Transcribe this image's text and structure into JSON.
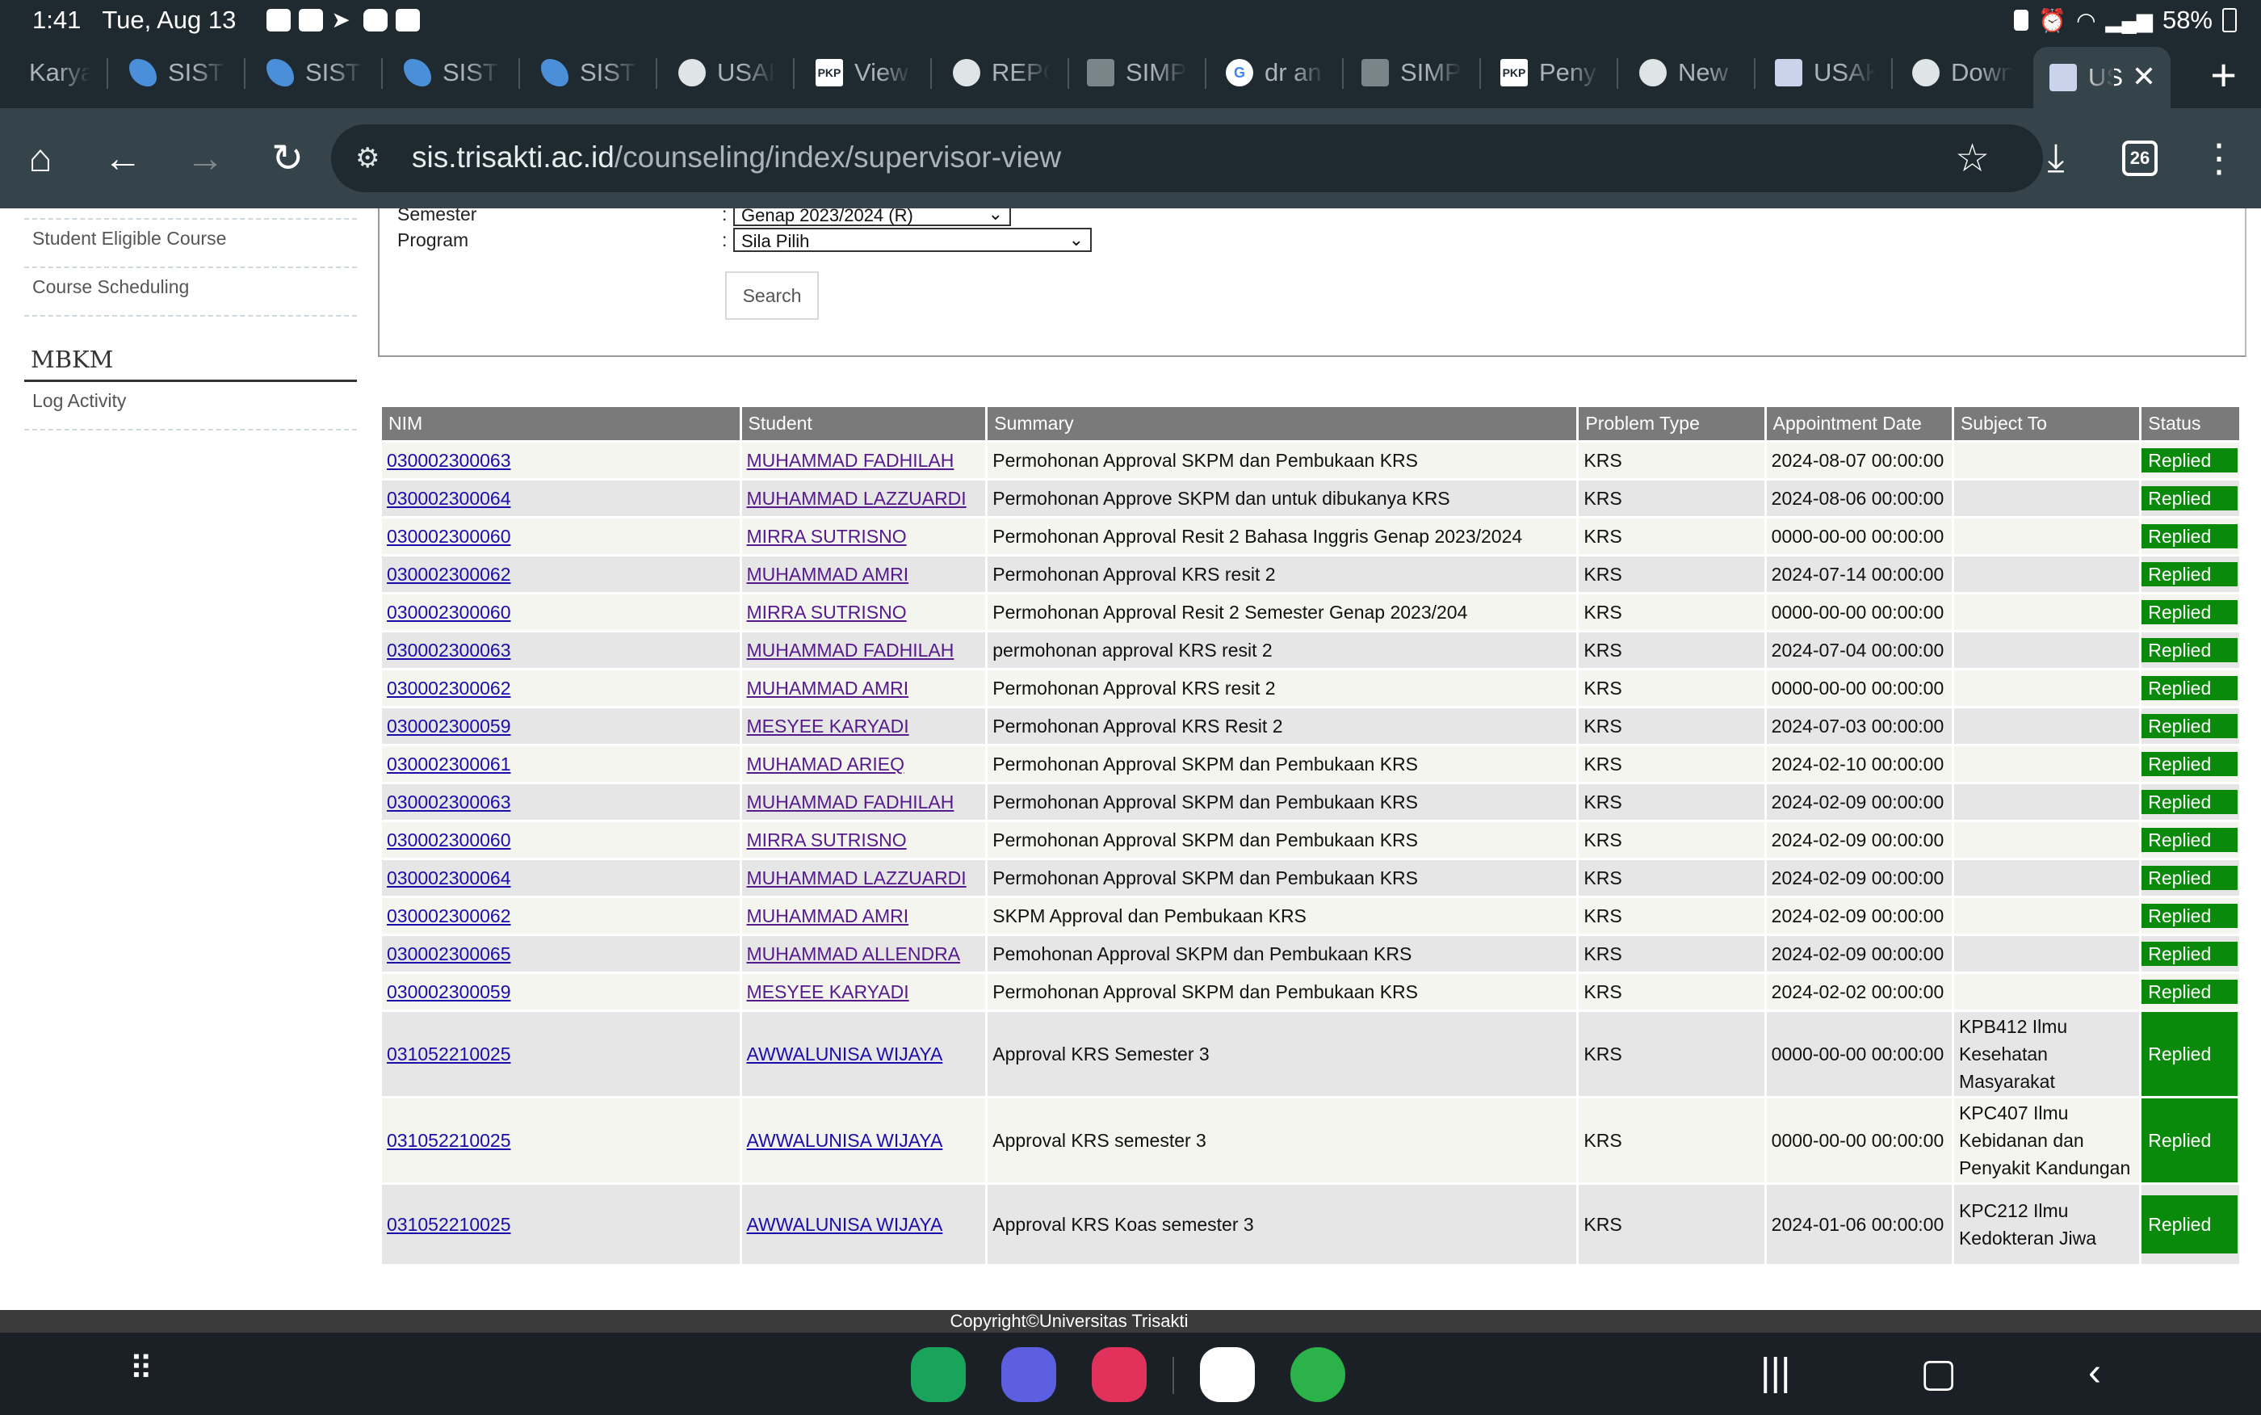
{
  "status_bar": {
    "time": "1:41",
    "date": "Tue, Aug 13",
    "battery": "58%",
    "notification_icons": [
      "youtube-icon",
      "calendar-icon",
      "telegram-icon",
      "app-icon",
      "gallery-icon"
    ],
    "system_icons": [
      "alarm-icon",
      "lock-icon",
      "wifi-icon",
      "signal-icon"
    ]
  },
  "tabs": [
    {
      "label": "Karya",
      "icon": "none"
    },
    {
      "label": "SISTE",
      "icon": "swirl-icon"
    },
    {
      "label": "SISTE",
      "icon": "swirl-icon"
    },
    {
      "label": "SISTE",
      "icon": "swirl-icon"
    },
    {
      "label": "SISTE",
      "icon": "swirl-icon"
    },
    {
      "label": "USAK",
      "icon": "globe-icon"
    },
    {
      "label": "View",
      "icon": "pkp-icon"
    },
    {
      "label": "REPO",
      "icon": "globe-icon"
    },
    {
      "label": "SIMP",
      "icon": "crest-icon"
    },
    {
      "label": "dr an",
      "icon": "google-icon"
    },
    {
      "label": "SIMP",
      "icon": "crest-icon"
    },
    {
      "label": "Peny",
      "icon": "pkp-icon"
    },
    {
      "label": "New",
      "icon": "chrome-icon"
    },
    {
      "label": "USAK",
      "icon": "usak-icon"
    },
    {
      "label": "Down",
      "icon": "chrome-icon"
    },
    {
      "label": "US",
      "icon": "usak-icon"
    }
  ],
  "toolbar": {
    "url_domain": "sis.trisakti.ac.id",
    "url_path": "/counseling/index/supervisor-view",
    "tab_count": "26"
  },
  "sidebar": {
    "items": [
      "Student Eligible Course",
      "Course Scheduling"
    ],
    "section_heading": "MBKM",
    "section_items": [
      "Log Activity"
    ]
  },
  "filters": {
    "semester_label": "Semester",
    "semester_value": "Genap 2023/2024 (R)",
    "program_label": "Program",
    "program_value": "Sila Pilih",
    "search_button": "Search"
  },
  "table": {
    "headers": [
      "NIM",
      "Student",
      "Summary",
      "Problem Type",
      "Appointment Date",
      "Subject To",
      "Status"
    ],
    "rows": [
      {
        "nim": "030002300063",
        "student": "MUHAMMAD FADHILAH",
        "summary": "Permohonan Approval SKPM dan Pembukaan KRS",
        "type": "KRS",
        "date": "2024-08-07 00:00:00",
        "subject": "",
        "status": "Replied"
      },
      {
        "nim": "030002300064",
        "student": "MUHAMMAD LAZZUARDI",
        "summary": "Permohonan Approve SKPM dan untuk dibukanya KRS",
        "type": "KRS",
        "date": "2024-08-06 00:00:00",
        "subject": "",
        "status": "Replied"
      },
      {
        "nim": "030002300060",
        "student": "MIRRA SUTRISNO",
        "summary": "Permohonan Approval Resit 2 Bahasa Inggris Genap 2023/2024",
        "type": "KRS",
        "date": "0000-00-00 00:00:00",
        "subject": "",
        "status": "Replied"
      },
      {
        "nim": "030002300062",
        "student": "MUHAMMAD AMRI",
        "summary": "Permohonan Approval KRS resit 2",
        "type": "KRS",
        "date": "2024-07-14 00:00:00",
        "subject": "",
        "status": "Replied"
      },
      {
        "nim": "030002300060",
        "student": "MIRRA SUTRISNO",
        "summary": "Permohonan Approval Resit 2 Semester Genap 2023/204",
        "type": "KRS",
        "date": "0000-00-00 00:00:00",
        "subject": "",
        "status": "Replied"
      },
      {
        "nim": "030002300063",
        "student": "MUHAMMAD FADHILAH",
        "summary": "permohonan approval KRS resit 2",
        "type": "KRS",
        "date": "2024-07-04 00:00:00",
        "subject": "",
        "status": "Replied"
      },
      {
        "nim": "030002300062",
        "student": "MUHAMMAD AMRI",
        "summary": "Permohonan Approval KRS resit 2",
        "type": "KRS",
        "date": "0000-00-00 00:00:00",
        "subject": "",
        "status": "Replied"
      },
      {
        "nim": "030002300059",
        "student": "MESYEE KARYADI",
        "summary": "Permohonan Approval KRS Resit 2",
        "type": "KRS",
        "date": "2024-07-03 00:00:00",
        "subject": "",
        "status": "Replied"
      },
      {
        "nim": "030002300061",
        "student": "MUHAMAD ARIEQ",
        "summary": "Permohonan Approval SKPM dan Pembukaan KRS",
        "type": "KRS",
        "date": "2024-02-10 00:00:00",
        "subject": "",
        "status": "Replied"
      },
      {
        "nim": "030002300063",
        "student": "MUHAMMAD FADHILAH",
        "summary": "Permohonan Approval SKPM dan Pembukaan KRS",
        "type": "KRS",
        "date": "2024-02-09 00:00:00",
        "subject": "",
        "status": "Replied"
      },
      {
        "nim": "030002300060",
        "student": "MIRRA SUTRISNO",
        "summary": "Permohonan Approval SKPM dan Pembukaan KRS",
        "type": "KRS",
        "date": "2024-02-09 00:00:00",
        "subject": "",
        "status": "Replied"
      },
      {
        "nim": "030002300064",
        "student": "MUHAMMAD LAZZUARDI",
        "summary": "Permohonan Approval SKPM dan Pembukaan KRS",
        "type": "KRS",
        "date": "2024-02-09 00:00:00",
        "subject": "",
        "status": "Replied"
      },
      {
        "nim": "030002300062",
        "student": "MUHAMMAD AMRI",
        "summary": "SKPM Approval dan Pembukaan KRS",
        "type": "KRS",
        "date": "2024-02-09 00:00:00",
        "subject": "",
        "status": "Replied"
      },
      {
        "nim": "030002300065",
        "student": "MUHAMMAD ALLENDRA",
        "summary": "Pemohonan Approval SKPM dan Pembukaan KRS",
        "type": "KRS",
        "date": "2024-02-09 00:00:00",
        "subject": "",
        "status": "Replied"
      },
      {
        "nim": "030002300059",
        "student": "MESYEE KARYADI",
        "summary": "Permohonan Approval SKPM dan Pembukaan KRS",
        "type": "KRS",
        "date": "2024-02-02 00:00:00",
        "subject": "",
        "status": "Replied"
      },
      {
        "nim": "031052210025",
        "student": "AWWALUNISA WIJAYA",
        "summary": "Approval KRS Semester 3",
        "type": "KRS",
        "date": "0000-00-00 00:00:00",
        "subject": "KPB412 Ilmu Kesehatan Masyarakat",
        "status": "Replied"
      },
      {
        "nim": "031052210025",
        "student": "AWWALUNISA WIJAYA",
        "summary": "Approval KRS semester 3",
        "type": "KRS",
        "date": "0000-00-00 00:00:00",
        "subject": "KPC407 Ilmu Kebidanan dan Penyakit Kandungan",
        "status": "Replied"
      },
      {
        "nim": "031052210025",
        "student": "AWWALUNISA WIJAYA",
        "summary": "Approval KRS Koas semester 3",
        "type": "KRS",
        "date": "2024-01-06 00:00:00",
        "subject": "KPC212 Ilmu Kedokteran Jiwa",
        "status": "Replied"
      }
    ]
  },
  "footer": {
    "copyright": "Copyright©Universitas Trisakti"
  },
  "colors": {
    "status_replied": "#0a8a0a",
    "table_header": "#7a7a7a",
    "browser_chrome": "#1f2a30"
  }
}
